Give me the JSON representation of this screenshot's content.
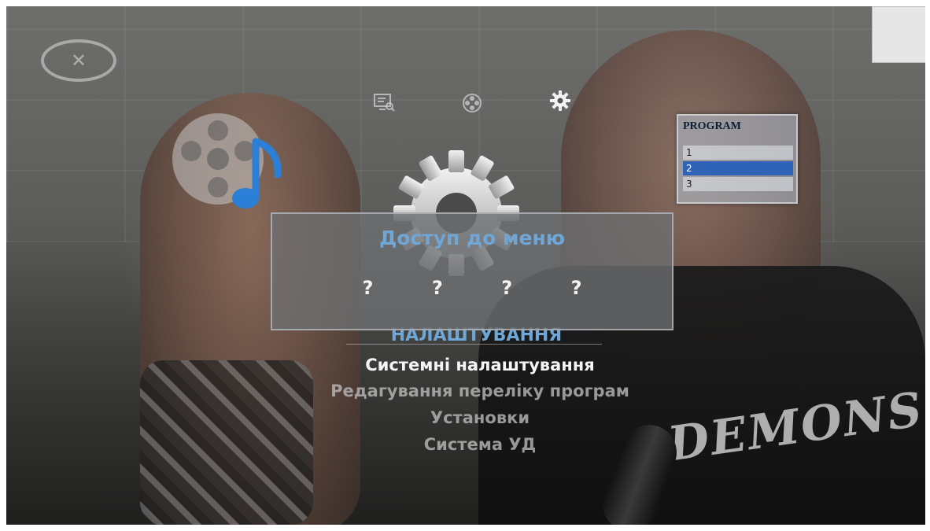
{
  "channel": {
    "logo_icon": "channel-logo-icon"
  },
  "top_icons": [
    {
      "name": "tv-guide-icon",
      "glyph": "⊟"
    },
    {
      "name": "media-reel-icon",
      "glyph": "⊛"
    },
    {
      "name": "settings-icon",
      "glyph": "⚙",
      "active": true
    }
  ],
  "program_widget": {
    "title": "PROGRAM",
    "rows": [
      "1",
      "2",
      "3"
    ],
    "selected_row": "2"
  },
  "pin_dialog": {
    "title": "Доступ до меню",
    "digits": [
      "?",
      "?",
      "?",
      "?"
    ]
  },
  "menu": {
    "header": "НАЛАШТУВАННЯ",
    "items": [
      {
        "label": "Системні налаштування",
        "selected": true
      },
      {
        "label": "Редагування переліку програм",
        "selected": false
      },
      {
        "label": "Установки",
        "selected": false
      },
      {
        "label": "Система УД",
        "selected": false
      }
    ]
  },
  "background": {
    "shirt_text": "DEMONS"
  },
  "colors": {
    "accent_blue": "#6fa6d6",
    "selected_text": "#f5f5f5",
    "list_selection": "#2e63b8"
  }
}
